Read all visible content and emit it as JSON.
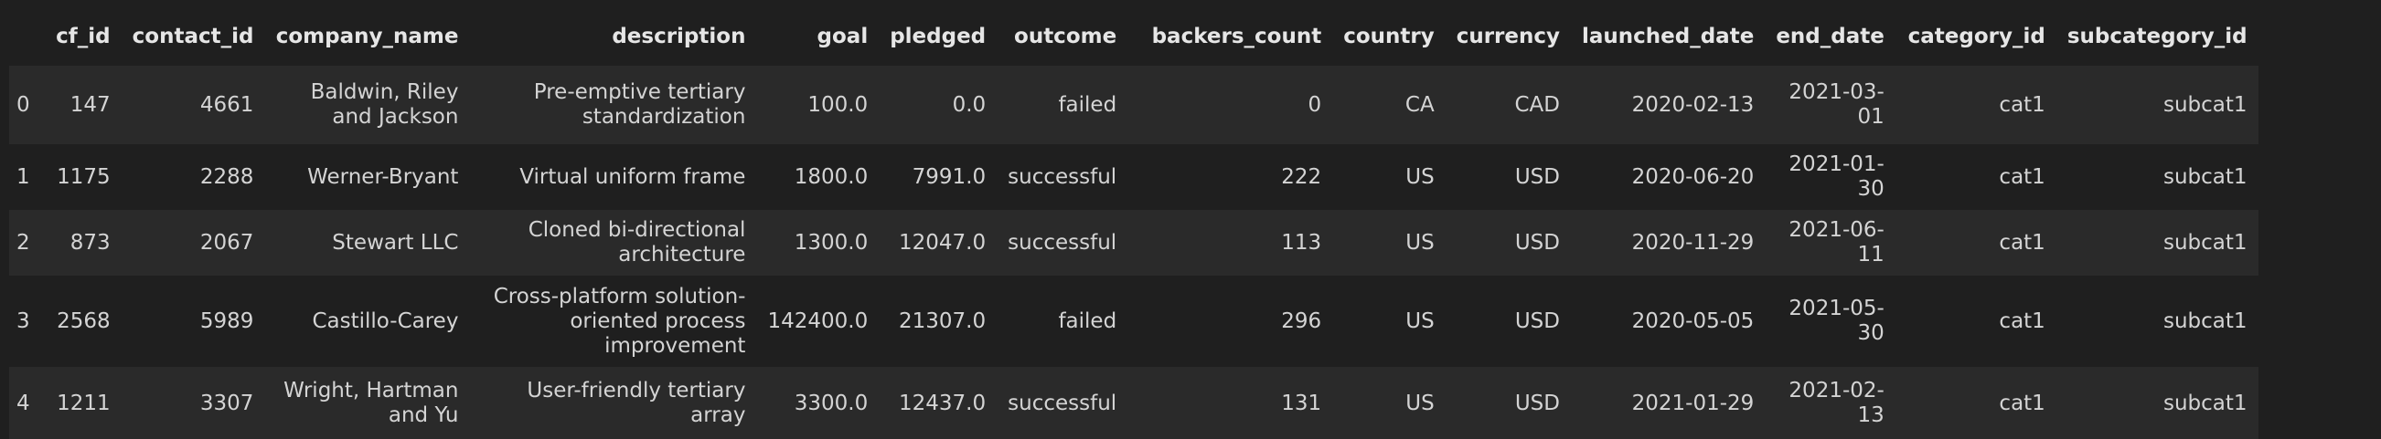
{
  "table": {
    "columns": [
      "",
      "cf_id",
      "contact_id",
      "company_name",
      "description",
      "goal",
      "pledged",
      "outcome",
      "backers_count",
      "country",
      "currency",
      "launched_date",
      "end_date",
      "category_id",
      "subcategory_id"
    ],
    "rows": [
      {
        "index": "0",
        "cf_id": "147",
        "contact_id": "4661",
        "company_name": "Baldwin, Riley and Jackson",
        "description": "Pre-emptive tertiary standardization",
        "goal": "100.0",
        "pledged": "0.0",
        "outcome": "failed",
        "backers_count": "0",
        "country": "CA",
        "currency": "CAD",
        "launched_date": "2020-02-13",
        "end_date": "2021-03-01",
        "category_id": "cat1",
        "subcategory_id": "subcat1"
      },
      {
        "index": "1",
        "cf_id": "1175",
        "contact_id": "2288",
        "company_name": "Werner-Bryant",
        "description": "Virtual uniform frame",
        "goal": "1800.0",
        "pledged": "7991.0",
        "outcome": "successful",
        "backers_count": "222",
        "country": "US",
        "currency": "USD",
        "launched_date": "2020-06-20",
        "end_date": "2021-01-30",
        "category_id": "cat1",
        "subcategory_id": "subcat1"
      },
      {
        "index": "2",
        "cf_id": "873",
        "contact_id": "2067",
        "company_name": "Stewart LLC",
        "description": "Cloned bi-directional architecture",
        "goal": "1300.0",
        "pledged": "12047.0",
        "outcome": "successful",
        "backers_count": "113",
        "country": "US",
        "currency": "USD",
        "launched_date": "2020-11-29",
        "end_date": "2021-06-11",
        "category_id": "cat1",
        "subcategory_id": "subcat1"
      },
      {
        "index": "3",
        "cf_id": "2568",
        "contact_id": "5989",
        "company_name": "Castillo-Carey",
        "description": "Cross-platform solution-oriented process improvement",
        "goal": "142400.0",
        "pledged": "21307.0",
        "outcome": "failed",
        "backers_count": "296",
        "country": "US",
        "currency": "USD",
        "launched_date": "2020-05-05",
        "end_date": "2021-05-30",
        "category_id": "cat1",
        "subcategory_id": "subcat1"
      },
      {
        "index": "4",
        "cf_id": "1211",
        "contact_id": "3307",
        "company_name": "Wright, Hartman and Yu",
        "description": "User-friendly tertiary array",
        "goal": "3300.0",
        "pledged": "12437.0",
        "outcome": "successful",
        "backers_count": "131",
        "country": "US",
        "currency": "USD",
        "launched_date": "2021-01-29",
        "end_date": "2021-02-13",
        "category_id": "cat1",
        "subcategory_id": "subcat1"
      }
    ]
  }
}
